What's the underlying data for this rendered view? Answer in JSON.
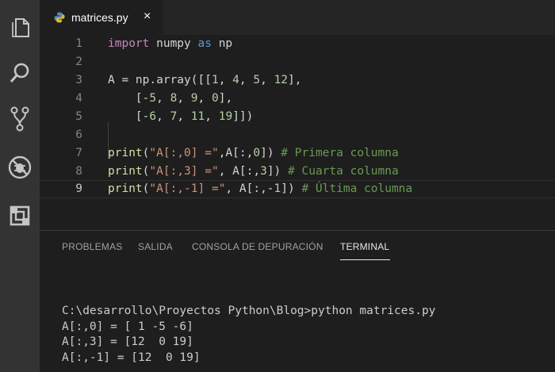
{
  "activity_bar": {
    "icons": [
      "files-icon",
      "search-icon",
      "source-control-icon",
      "debug-icon",
      "extensions-icon"
    ]
  },
  "tab": {
    "filename": "matrices.py",
    "close_glyph": "×"
  },
  "editor": {
    "lines": [
      {
        "n": "1",
        "tokens": [
          [
            "kw",
            "import"
          ],
          [
            "p",
            " numpy "
          ],
          [
            "as",
            "as"
          ],
          [
            "p",
            " np"
          ]
        ]
      },
      {
        "n": "2",
        "tokens": []
      },
      {
        "n": "3",
        "tokens": [
          [
            "p",
            "A = np.array([["
          ],
          [
            "num",
            "1"
          ],
          [
            "p",
            ", "
          ],
          [
            "num",
            "4"
          ],
          [
            "p",
            ", "
          ],
          [
            "num",
            "5"
          ],
          [
            "p",
            ", "
          ],
          [
            "num",
            "12"
          ],
          [
            "p",
            "],"
          ]
        ]
      },
      {
        "n": "4",
        "tokens": [
          [
            "p",
            "    [-"
          ],
          [
            "num",
            "5"
          ],
          [
            "p",
            ", "
          ],
          [
            "num",
            "8"
          ],
          [
            "p",
            ", "
          ],
          [
            "num",
            "9"
          ],
          [
            "p",
            ", "
          ],
          [
            "num",
            "0"
          ],
          [
            "p",
            "],"
          ]
        ]
      },
      {
        "n": "5",
        "tokens": [
          [
            "p",
            "    [-"
          ],
          [
            "num",
            "6"
          ],
          [
            "p",
            ", "
          ],
          [
            "num",
            "7"
          ],
          [
            "p",
            ", "
          ],
          [
            "num",
            "11"
          ],
          [
            "p",
            ", "
          ],
          [
            "num",
            "19"
          ],
          [
            "p",
            "]])"
          ]
        ]
      },
      {
        "n": "6",
        "tokens": []
      },
      {
        "n": "7",
        "tokens": [
          [
            "fn",
            "print"
          ],
          [
            "p",
            "("
          ],
          [
            "str",
            "\"A[:,0] =\""
          ],
          [
            "p",
            ",A[:,"
          ],
          [
            "num",
            "0"
          ],
          [
            "p",
            "]) "
          ],
          [
            "cm",
            "# Primera columna"
          ]
        ]
      },
      {
        "n": "8",
        "tokens": [
          [
            "fn",
            "print"
          ],
          [
            "p",
            "("
          ],
          [
            "str",
            "\"A[:,3] =\""
          ],
          [
            "p",
            ", A[:,"
          ],
          [
            "num",
            "3"
          ],
          [
            "p",
            "]) "
          ],
          [
            "cm",
            "# Cuarta columna"
          ]
        ]
      },
      {
        "n": "9",
        "tokens": [
          [
            "fn",
            "print"
          ],
          [
            "p",
            "("
          ],
          [
            "str",
            "\"A[:,-1] =\""
          ],
          [
            "p",
            ", A[:,-"
          ],
          [
            "num",
            "1"
          ],
          [
            "p",
            "]) "
          ],
          [
            "cm",
            "# Última columna"
          ]
        ]
      }
    ]
  },
  "panel": {
    "tabs": [
      "PROBLEMAS",
      "SALIDA",
      "CONSOLA DE DEPURACIÓN",
      "TERMINAL"
    ],
    "active_tab": "TERMINAL"
  },
  "terminal": {
    "command": "C:\\desarrollo\\Proyectos Python\\Blog>python matrices.py",
    "out1": "A[:,0] = [ 1 -5 -6]",
    "out2": "A[:,3] = [12  0 19]",
    "out3": "A[:,-1] = [12  0 19]"
  },
  "colors": {
    "keyword": "#c586c0",
    "string": "#ce9178",
    "number": "#b5cea8",
    "comment": "#6a9955",
    "function": "#dcdcaa"
  }
}
